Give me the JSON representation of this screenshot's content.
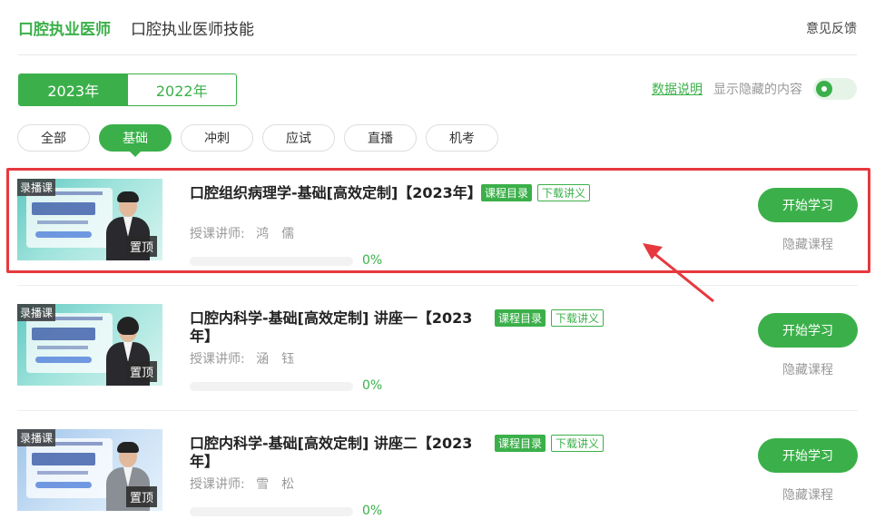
{
  "top_tabs": [
    {
      "label": "口腔执业医师",
      "active": true
    },
    {
      "label": "口腔执业医师技能",
      "active": false
    }
  ],
  "feedback_label": "意见反馈",
  "years": [
    {
      "label": "2023年",
      "active": true
    },
    {
      "label": "2022年",
      "active": false
    }
  ],
  "data_link": "数据说明",
  "show_hidden_label": "显示隐藏的内容",
  "show_hidden_on": true,
  "filters": [
    {
      "label": "全部",
      "active": false
    },
    {
      "label": "基础",
      "active": true
    },
    {
      "label": "冲刺",
      "active": false
    },
    {
      "label": "应试",
      "active": false
    },
    {
      "label": "直播",
      "active": false
    },
    {
      "label": "机考",
      "active": false
    }
  ],
  "courses": [
    {
      "record_tag": "录播课",
      "pin_tag": "置顶",
      "title": "口腔组织病理学-基础[高效定制]【2023年】",
      "catalog_label": "课程目录",
      "download_label": "下载讲义",
      "teacher_prefix": "授课讲师:",
      "teacher_name": "鸿　儒",
      "progress_percent": 0,
      "progress_text": "0%",
      "start_label": "开始学习",
      "hide_label": "隐藏课程",
      "thumb_style": "teal"
    },
    {
      "record_tag": "录播课",
      "pin_tag": "置顶",
      "title": "口腔内科学-基础[高效定制] 讲座一【2023年】",
      "catalog_label": "课程目录",
      "download_label": "下载讲义",
      "teacher_prefix": "授课讲师:",
      "teacher_name": "涵　钰",
      "progress_percent": 0,
      "progress_text": "0%",
      "start_label": "开始学习",
      "hide_label": "隐藏课程",
      "thumb_style": "teal"
    },
    {
      "record_tag": "录播课",
      "pin_tag": "置顶",
      "title": "口腔内科学-基础[高效定制] 讲座二【2023年】",
      "catalog_label": "课程目录",
      "download_label": "下载讲义",
      "teacher_prefix": "授课讲师:",
      "teacher_name": "雪　松",
      "progress_percent": 0,
      "progress_text": "0%",
      "start_label": "开始学习",
      "hide_label": "隐藏课程",
      "thumb_style": "blue"
    }
  ],
  "colors": {
    "accent": "#3bb04a",
    "highlight": "#e6393f"
  }
}
